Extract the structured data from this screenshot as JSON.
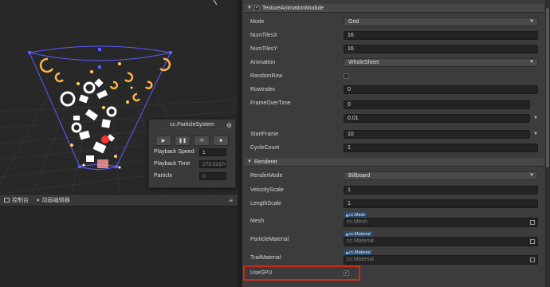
{
  "scene": {
    "bottom_tabs": [
      {
        "label": "控制台"
      },
      {
        "label": "动画编辑器"
      }
    ],
    "tabs_menu_label": "≡"
  },
  "particle_panel": {
    "title": "cc.ParticleSystem",
    "gear_icon": "gear-icon",
    "buttons": [
      {
        "name": "play",
        "icon": "▶"
      },
      {
        "name": "pause",
        "icon": "❚❚"
      },
      {
        "name": "restart",
        "icon": "⟲"
      },
      {
        "name": "stop",
        "icon": "■"
      }
    ],
    "rows": [
      {
        "label": "Playback Speed",
        "value": "1"
      },
      {
        "label": "Playback Time",
        "value": "273.0237455"
      },
      {
        "label": "Particle",
        "value": "0"
      }
    ]
  },
  "inspector": {
    "texture_section": {
      "title": "TextureAnimationModule",
      "checked": true,
      "props": {
        "mode": {
          "label": "Mode",
          "value": "Grid"
        },
        "num_tiles_x": {
          "label": "NumTilesX",
          "value": "16"
        },
        "num_tiles_y": {
          "label": "NumTilesY",
          "value": "16"
        },
        "animation": {
          "label": "Animation",
          "value": "WholeSheet"
        },
        "random_row": {
          "label": "RandomRow"
        },
        "row_index": {
          "label": "RowIndex",
          "value": "0"
        },
        "frame_over_time": {
          "label": "FrameOverTime",
          "value1": "0",
          "value2": "0.01"
        },
        "start_frame": {
          "label": "StartFrame",
          "value": "10"
        },
        "cycle_count": {
          "label": "CycleCount",
          "value": "1"
        }
      }
    },
    "renderer_section": {
      "title": "Renderer",
      "props": {
        "render_mode": {
          "label": "RenderMode",
          "value": "Billboard"
        },
        "velocity_scale": {
          "label": "VelocityScale",
          "value": "1"
        },
        "length_scale": {
          "label": "LengthScale",
          "value": "1"
        },
        "mesh": {
          "label": "Mesh",
          "tag": "cc.Mesh",
          "placeholder": "cc.Mesh"
        },
        "particle_material": {
          "label": "ParticleMaterial",
          "tag": "cc.Material",
          "placeholder": "cc.Material"
        },
        "trail_material": {
          "label": "TrailMaterial",
          "tag": "cc.Material",
          "placeholder": "cc.Material"
        },
        "use_gpu": {
          "label": "UseGPU",
          "checked": true
        }
      }
    }
  },
  "colors": {
    "highlight": "#d0291d",
    "gizmo": "#5b5bff",
    "particle": "#ffb347"
  }
}
